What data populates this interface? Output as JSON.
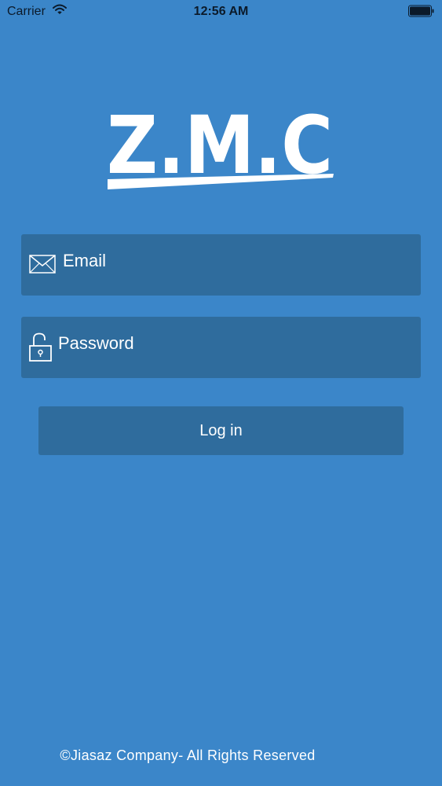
{
  "status_bar": {
    "carrier": "Carrier",
    "time": "12:56 AM",
    "icons": [
      "wifi-icon",
      "battery-icon"
    ]
  },
  "logo": {
    "text": "Z.M.C"
  },
  "form": {
    "email": {
      "placeholder": "Email",
      "value": "",
      "icon": "envelope-icon"
    },
    "password": {
      "placeholder": "Password",
      "value": "",
      "icon": "unlocked-padlock-icon"
    },
    "login_label": "Log in"
  },
  "footer": {
    "text": "©Jiasaz Company- All Rights Reserved"
  },
  "colors": {
    "background": "#3b86c9",
    "field_background": "#2f6c9d",
    "text": "#ffffff",
    "status_text": "#0b1a2a"
  }
}
